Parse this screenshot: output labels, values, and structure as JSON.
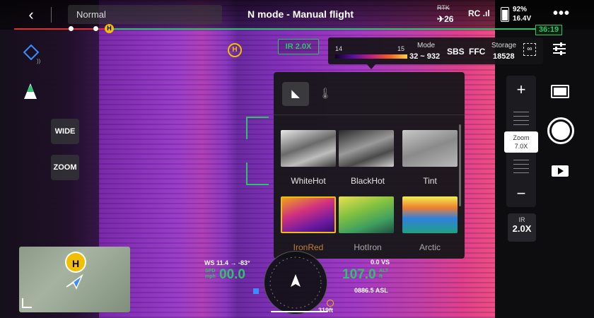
{
  "topbar": {
    "back_icon": "back-chevron-icon",
    "mode": "Normal",
    "title": "N mode - Manual flight",
    "rtk_label": "RTK",
    "satellites": "26",
    "rc_label": "RC",
    "battery_pct": "92%",
    "battery_voltage": "16.4V",
    "more_icon": "more-icon"
  },
  "progress": {
    "home_marker": "H",
    "timer": "36:19"
  },
  "left_controls": {
    "wide_label": "WIDE",
    "zoom_label": "ZOOM"
  },
  "feed": {
    "home_marker": "H",
    "ir_zoom_tag": "IR 2.0X"
  },
  "thermal": {
    "scale_min": "14",
    "scale_max": "15",
    "mode_label": "Mode",
    "range": "32 ~ 932",
    "sbs_label": "SBS",
    "ffc_label": "FFC",
    "storage_label": "Storage",
    "storage_value": "18528"
  },
  "palette_panel": {
    "palettes": [
      {
        "label": "WhiteHot",
        "selected": false
      },
      {
        "label": "BlackHot",
        "selected": false
      },
      {
        "label": "Tint",
        "selected": false
      },
      {
        "label": "IronRed",
        "selected": true
      },
      {
        "label": "HotIron",
        "selected": false
      },
      {
        "label": "Arctic",
        "selected": false
      }
    ]
  },
  "right_controls": {
    "zoom_in": "+",
    "zoom_out": "−",
    "zoom_caption": "Zoom",
    "zoom_value": "7.0X",
    "ir_label": "IR",
    "ir_value": "2.0X"
  },
  "map": {
    "home_marker": "H"
  },
  "telemetry": {
    "wind": "WS 11.4 → -83°",
    "speed_unit_top": "SPD",
    "speed_unit_bottom": "mph",
    "speed_value": "00.0",
    "vs": "0.0 VS",
    "alt_value": "107.0",
    "alt_unit_top": "ALT",
    "alt_unit_bottom": "ft",
    "asl": "0886.5 ASL",
    "distance": "319ft"
  },
  "colors": {
    "accent_green": "#2ec36a",
    "home_yellow": "#f0c000",
    "selected_border": "#f0c000"
  }
}
